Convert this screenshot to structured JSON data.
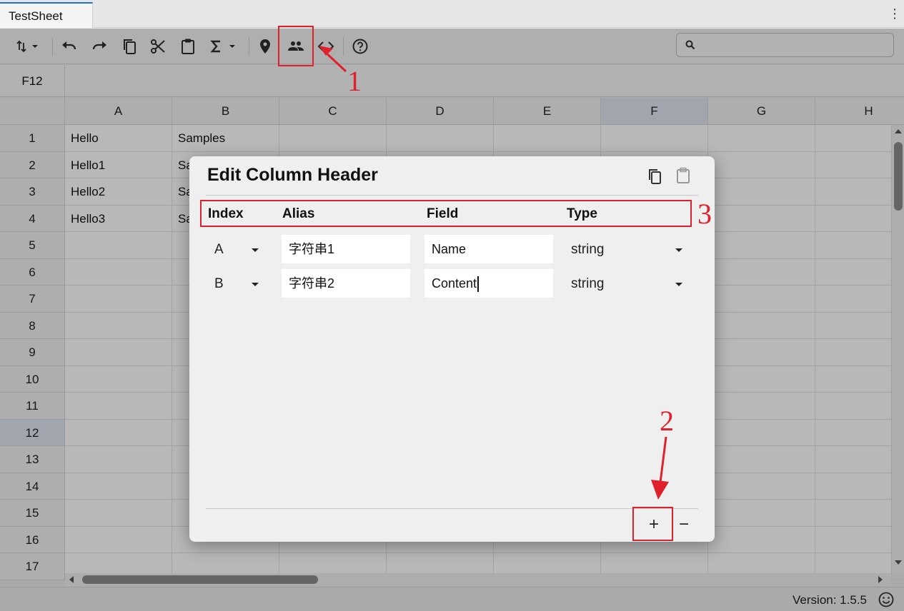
{
  "tab": {
    "title": "TestSheet"
  },
  "search": {
    "placeholder": "",
    "value": ""
  },
  "formula_bar": {
    "cell_ref": "F12",
    "value": ""
  },
  "grid": {
    "columns": [
      "A",
      "B",
      "C",
      "D",
      "E",
      "F",
      "G",
      "H"
    ],
    "selected_column": "F",
    "rows": [
      "1",
      "2",
      "3",
      "4",
      "5",
      "6",
      "7",
      "8",
      "9",
      "10",
      "11",
      "12",
      "13",
      "14",
      "15",
      "16",
      "17"
    ],
    "selected_row": "12",
    "cells": {
      "A1": "Hello",
      "B1": "Samples",
      "A2": "Hello1",
      "B2": "Sa",
      "A3": "Hello2",
      "B3": "Sa",
      "A4": "Hello3",
      "B4": "Sa"
    }
  },
  "dialog": {
    "title": "Edit Column Header",
    "headers": {
      "index": "Index",
      "alias": "Alias",
      "field": "Field",
      "type": "Type"
    },
    "rows": [
      {
        "index": "A",
        "alias": "字符串1",
        "field": "Name",
        "type": "string"
      },
      {
        "index": "B",
        "alias": "字符串2",
        "field": "Content",
        "type": "string"
      }
    ],
    "add_label": "+",
    "remove_label": "−"
  },
  "status": {
    "version": "Version: 1.5.5"
  },
  "annotations": {
    "n1": "1",
    "n2": "2",
    "n3": "3",
    "color": "#e0202a"
  },
  "icons": [
    "sort-icon",
    "undo-icon",
    "redo-icon",
    "copy-icon",
    "cut-icon",
    "clipboard-icon",
    "sum-icon",
    "location-pin-icon",
    "people-icon",
    "code-icon",
    "help-icon",
    "search-icon",
    "kebab-menu-icon",
    "smiley-icon"
  ]
}
